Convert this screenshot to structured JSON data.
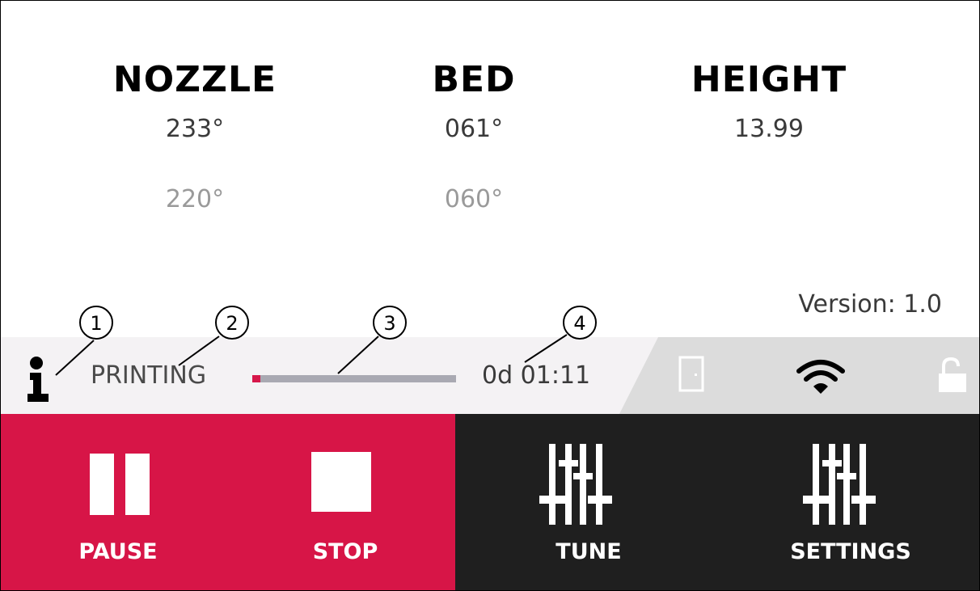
{
  "readings": {
    "nozzle": {
      "title": "NOZZLE",
      "current": "233°",
      "target": "220°"
    },
    "bed": {
      "title": "BED",
      "current": "061°",
      "target": "060°"
    },
    "height": {
      "title": "HEIGHT",
      "value": "13.99"
    }
  },
  "version": "Version: 1.0",
  "status": {
    "icon": "info-icon",
    "state": "PRINTING",
    "progress_fraction": 0.04,
    "elapsed": "0d 01:11",
    "indicators": [
      "door-icon",
      "wifi-icon",
      "unlocked-icon"
    ]
  },
  "callouts": [
    "1",
    "2",
    "3",
    "4"
  ],
  "buttons": [
    {
      "label": "PAUSE",
      "icon": "pause-icon"
    },
    {
      "label": "STOP",
      "icon": "stop-icon"
    },
    {
      "label": "TUNE",
      "icon": "sliders-icon"
    },
    {
      "label": "SETTINGS",
      "icon": "sliders-icon"
    }
  ],
  "colors": {
    "accent": "#d71547",
    "dark": "#1f1f1f",
    "status_bg": "#f4f2f4"
  }
}
